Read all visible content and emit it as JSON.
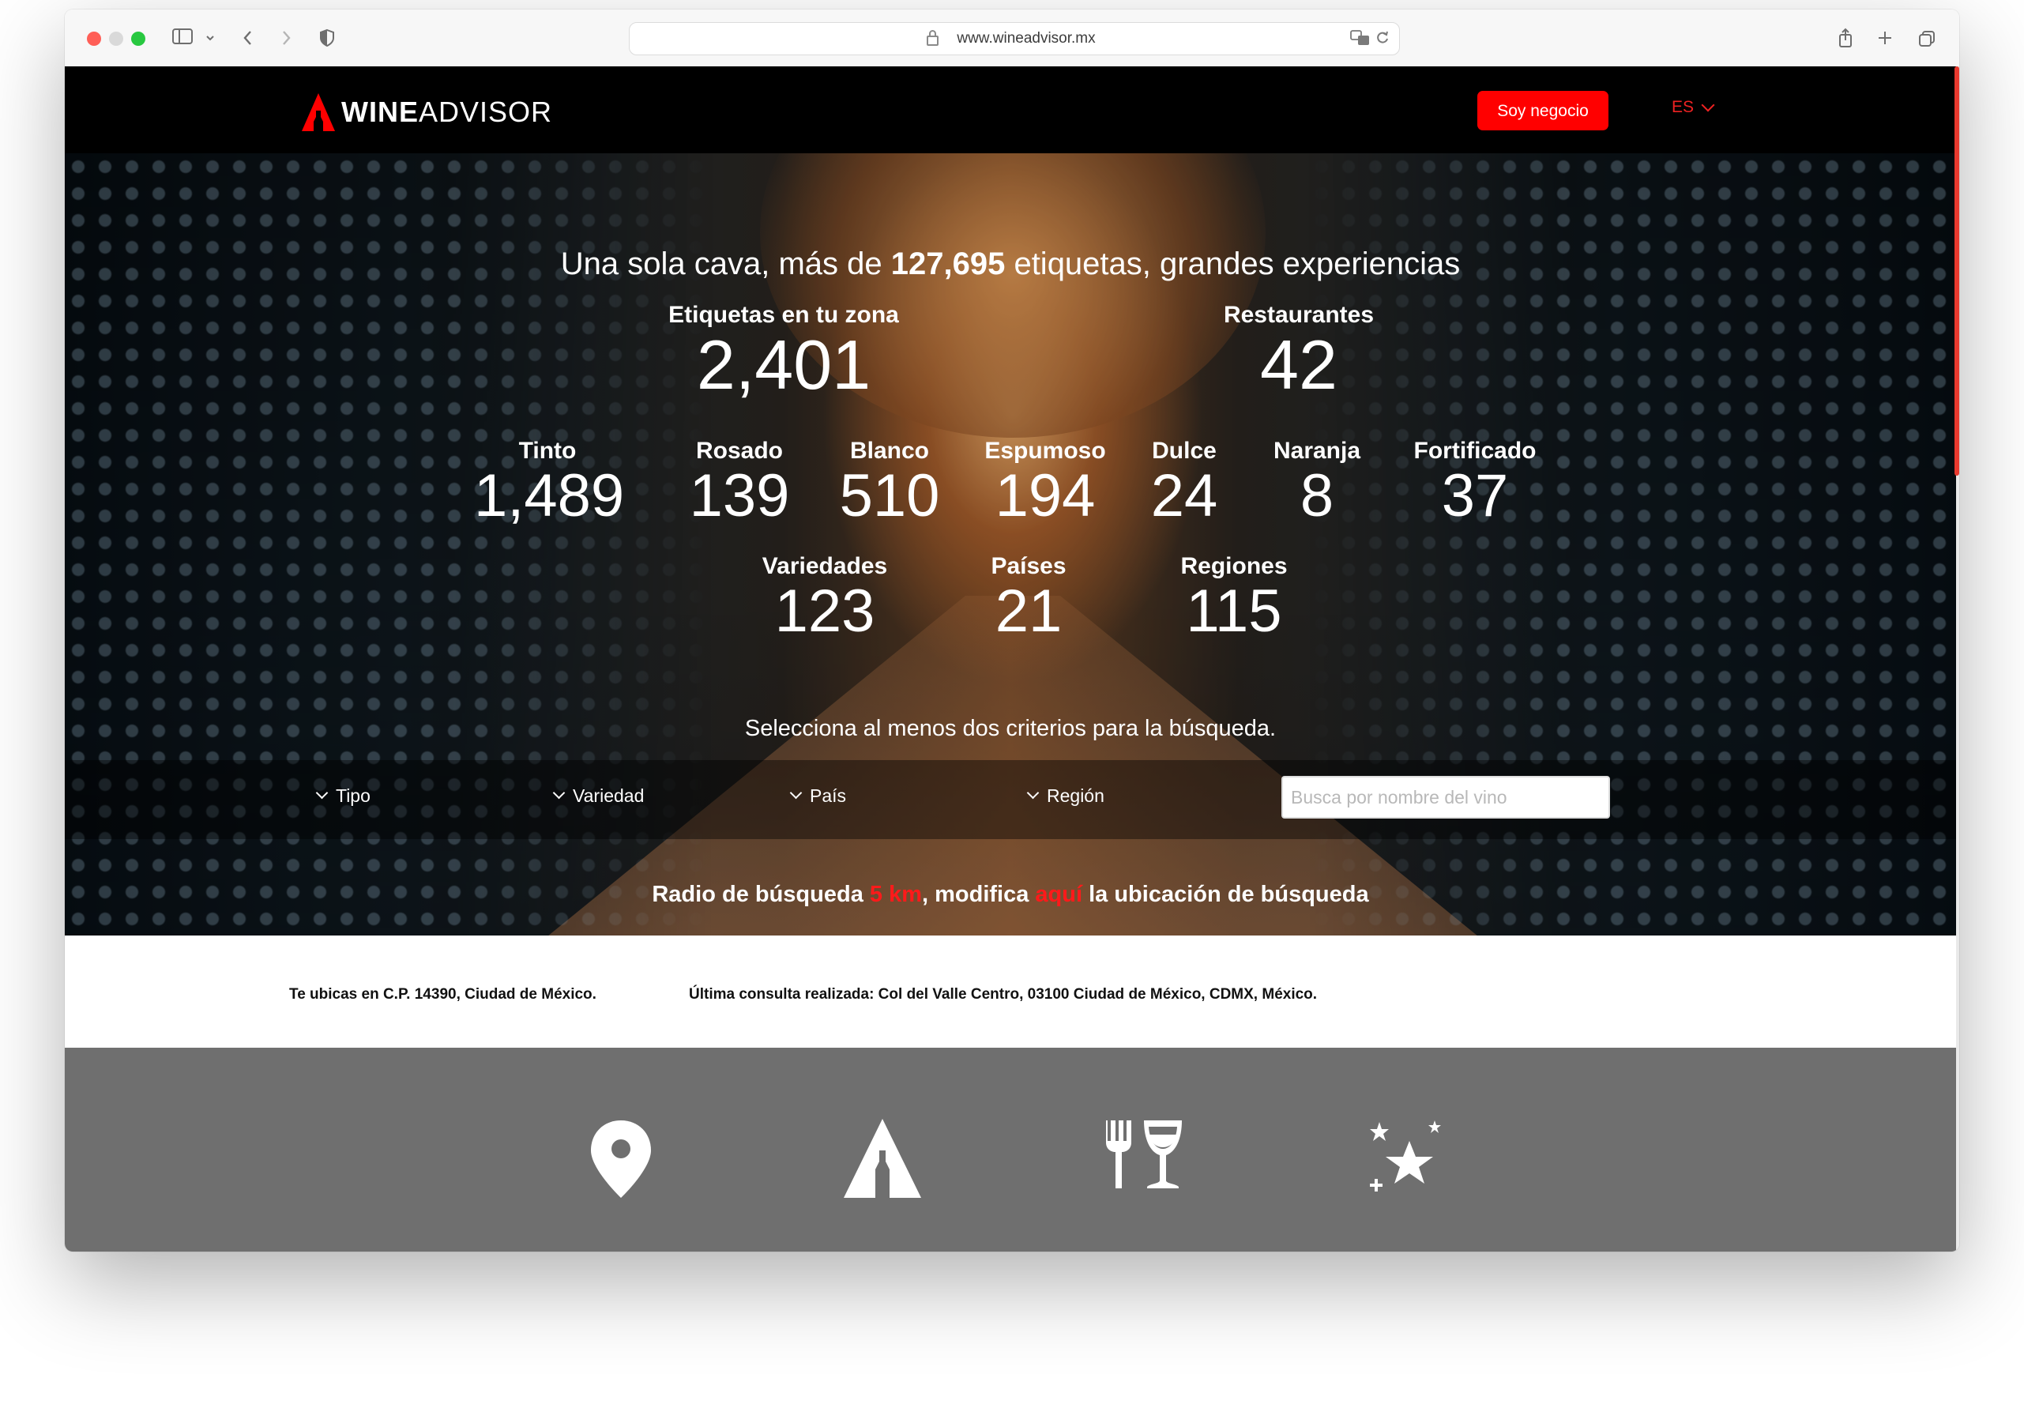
{
  "browser": {
    "url": "www.wineadvisor.mx"
  },
  "header": {
    "logo_wine": "WINE",
    "logo_advisor": "ADVISOR",
    "business_button": "Soy negocio",
    "language": "ES"
  },
  "hero": {
    "title_before": "Una sola cava, más de ",
    "title_count": "127,695",
    "title_after": " etiquetas, grandes experiencias",
    "primary_stats": [
      {
        "label": "Etiquetas en tu zona",
        "value": "2,401"
      },
      {
        "label": "Restaurantes",
        "value": "42"
      }
    ],
    "wine_types": [
      {
        "label": "Tinto",
        "value": "1,489"
      },
      {
        "label": "Rosado",
        "value": "139"
      },
      {
        "label": "Blanco",
        "value": "510"
      },
      {
        "label": "Espumoso",
        "value": "194"
      },
      {
        "label": "Dulce",
        "value": "24"
      },
      {
        "label": "Naranja",
        "value": "8"
      },
      {
        "label": "Fortificado",
        "value": "37"
      }
    ],
    "secondary_stats": [
      {
        "label": "Variedades",
        "value": "123"
      },
      {
        "label": "Países",
        "value": "21"
      },
      {
        "label": "Regiones",
        "value": "115"
      }
    ],
    "criteria_note": "Selecciona al menos dos criterios para la búsqueda.",
    "filters": [
      "Tipo",
      "Variedad",
      "País",
      "Región"
    ],
    "search_placeholder": "Busca por nombre del vino",
    "radius_prefix": "Radio de búsqueda ",
    "radius_value": "5 km",
    "radius_middle": ", modifica ",
    "radius_link": "aquí",
    "radius_suffix": " la ubicación de búsqueda"
  },
  "location": {
    "current": "Te ubicas en C.P. 14390, Ciudad de México.",
    "last_query": "Última consulta realizada: Col del Valle Centro, 03100 Ciudad de México, CDMX, México."
  },
  "features": {
    "icons": [
      "location-pin-icon",
      "wine-bottle-icon",
      "restaurant-icon",
      "stars-icon"
    ]
  },
  "colors": {
    "brand_red": "#ff0000",
    "header_bg": "#000000",
    "feature_bg": "#6f6f6f"
  }
}
